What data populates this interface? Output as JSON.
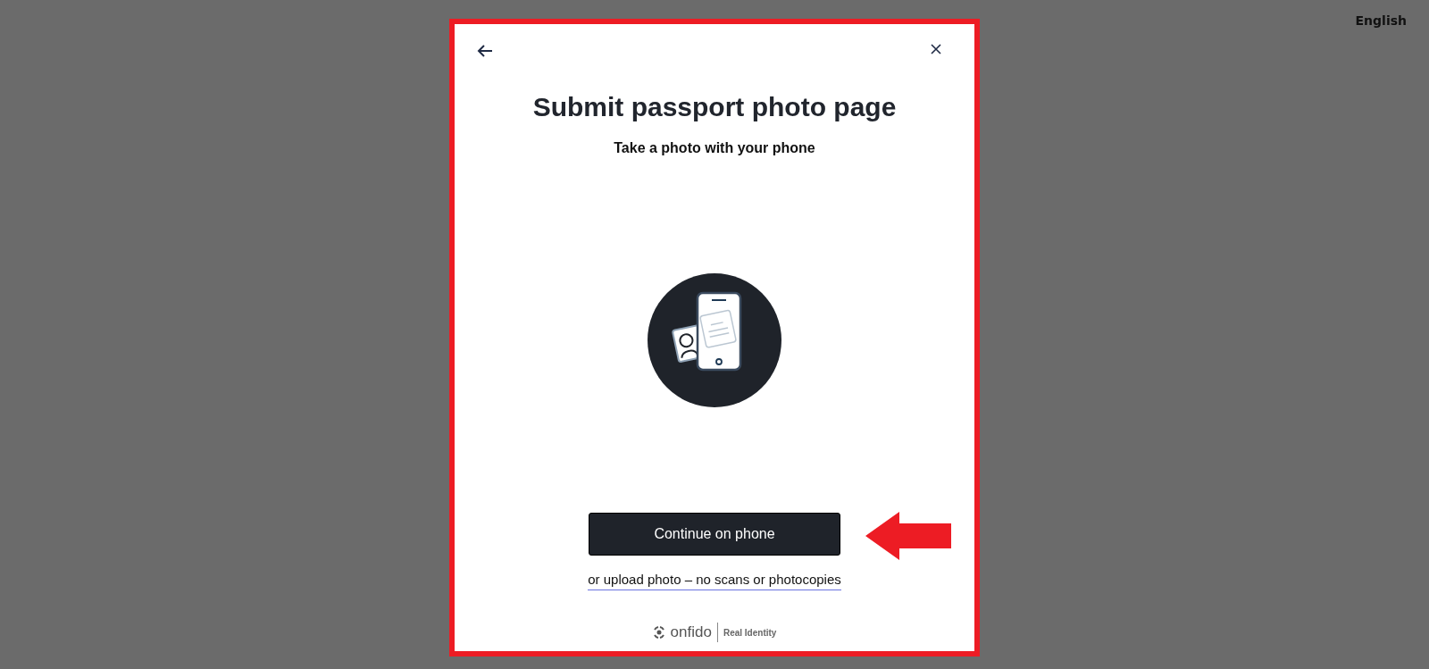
{
  "language": "English",
  "modal": {
    "title": "Submit passport photo page",
    "subtitle": "Take a photo with your phone",
    "primary_button": "Continue on phone",
    "secondary_link": "or upload photo – no scans or photocopies",
    "footer": {
      "brand": "onfido",
      "tagline": "Real Identity"
    }
  }
}
